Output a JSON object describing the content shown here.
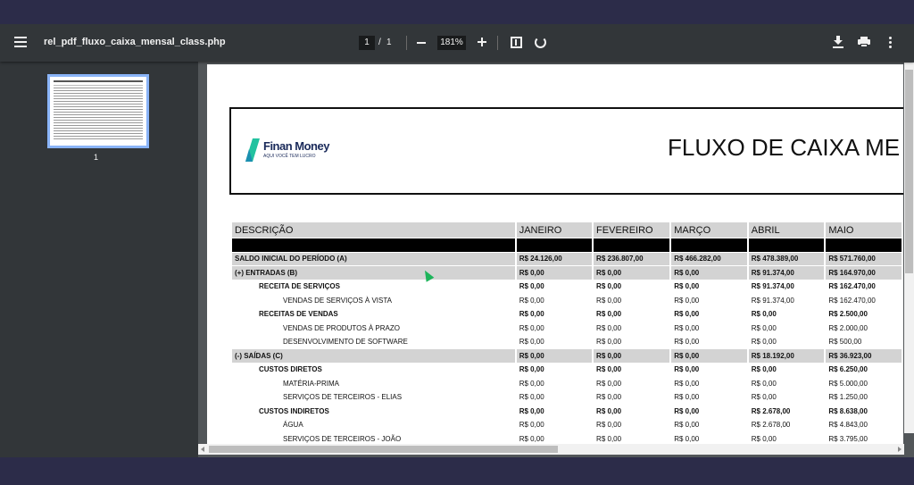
{
  "toolbar": {
    "file_name": "rel_pdf_fluxo_caixa_mensal_class.php",
    "current_page": "1",
    "page_separator": "/",
    "total_pages": "1",
    "zoom": "181%"
  },
  "sidebar": {
    "thumbnail_page_number": "1"
  },
  "document": {
    "logo_name": "Finan Money",
    "logo_tagline": "AQUI VOCÊ TEM LUCRO",
    "title": "FLUXO DE CAIXA ME",
    "columns": [
      "DESCRIÇÃO",
      "JANEIRO",
      "FEVEREIRO",
      "MARÇO",
      "ABRIL",
      "MAIO"
    ],
    "rows": [
      {
        "desc": "SALDO INICIAL DO PERÍODO (A)",
        "values": [
          "R$ 24.126,00",
          "R$ 236.807,00",
          "R$ 466.282,00",
          "R$ 478.389,00",
          "R$ 571.760,00"
        ]
      },
      {
        "desc": "(+) ENTRADAS (B)",
        "values": [
          "R$ 0,00",
          "R$ 0,00",
          "R$ 0,00",
          "R$ 91.374,00",
          "R$ 164.970,00"
        ]
      },
      {
        "desc": "RECEITA DE SERVIÇOS",
        "values": [
          "R$ 0,00",
          "R$ 0,00",
          "R$ 0,00",
          "R$ 91.374,00",
          "R$ 162.470,00"
        ]
      },
      {
        "desc": "VENDAS DE SERVIÇOS À VISTA",
        "values": [
          "R$ 0,00",
          "R$ 0,00",
          "R$ 0,00",
          "R$ 91.374,00",
          "R$ 162.470,00"
        ]
      },
      {
        "desc": "RECEITAS DE VENDAS",
        "values": [
          "R$ 0,00",
          "R$ 0,00",
          "R$ 0,00",
          "R$ 0,00",
          "R$ 2.500,00"
        ]
      },
      {
        "desc": "VENDAS DE PRODUTOS À PRAZO",
        "values": [
          "R$ 0,00",
          "R$ 0,00",
          "R$ 0,00",
          "R$ 0,00",
          "R$ 2.000,00"
        ]
      },
      {
        "desc": "DESENVOLVIMENTO DE SOFTWARE",
        "values": [
          "R$ 0,00",
          "R$ 0,00",
          "R$ 0,00",
          "R$ 0,00",
          "R$ 500,00"
        ]
      },
      {
        "desc": "(-) SAÍDAS (C)",
        "values": [
          "R$ 0,00",
          "R$ 0,00",
          "R$ 0,00",
          "R$ 18.192,00",
          "R$ 36.923,00"
        ]
      },
      {
        "desc": "CUSTOS DIRETOS",
        "values": [
          "R$ 0,00",
          "R$ 0,00",
          "R$ 0,00",
          "R$ 0,00",
          "R$ 6.250,00"
        ]
      },
      {
        "desc": "MATÉRIA-PRIMA",
        "values": [
          "R$ 0,00",
          "R$ 0,00",
          "R$ 0,00",
          "R$ 0,00",
          "R$ 5.000,00"
        ]
      },
      {
        "desc": "SERVIÇOS DE TERCEIROS - ELIAS",
        "values": [
          "R$ 0,00",
          "R$ 0,00",
          "R$ 0,00",
          "R$ 0,00",
          "R$ 1.250,00"
        ]
      },
      {
        "desc": "CUSTOS INDIRETOS",
        "values": [
          "R$ 0,00",
          "R$ 0,00",
          "R$ 0,00",
          "R$ 2.678,00",
          "R$ 8.638,00"
        ]
      },
      {
        "desc": "ÁGUA",
        "values": [
          "R$ 0,00",
          "R$ 0,00",
          "R$ 0,00",
          "R$ 2.678,00",
          "R$ 4.843,00"
        ]
      },
      {
        "desc": "SERVIÇOS DE TERCEIROS - JOÃO",
        "values": [
          "R$ 0,00",
          "R$ 0,00",
          "R$ 0,00",
          "R$ 0,00",
          "R$ 3.795,00"
        ]
      }
    ]
  },
  "colors": {
    "toolbar_bg": "#323639",
    "viewer_bg": "#525659",
    "frame_bg": "#2c2c49",
    "row_shade": "#d3d3d3",
    "logo_accent": "#23c2a0",
    "logo_text": "#1a2a5a"
  }
}
